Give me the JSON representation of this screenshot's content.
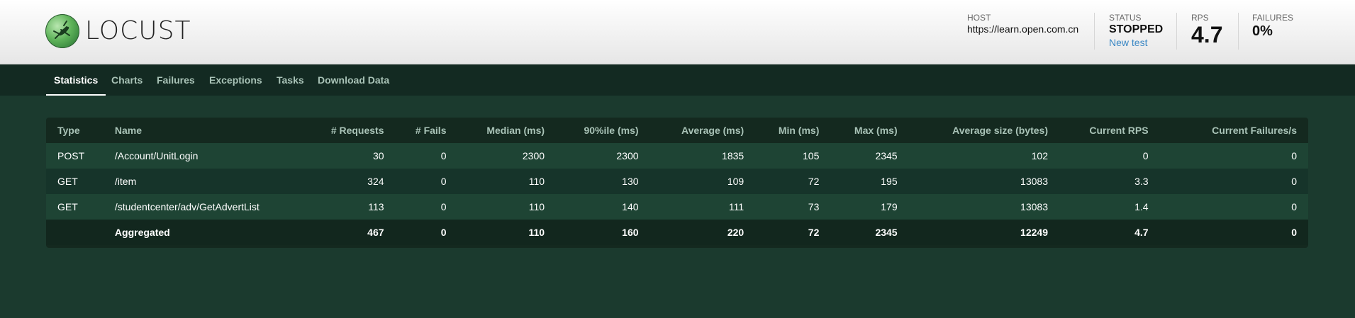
{
  "app": {
    "logo_text": "LOCUST"
  },
  "header": {
    "host_label": "HOST",
    "host_value": "https://learn.open.com.cn",
    "status_label": "STATUS",
    "status_value": "STOPPED",
    "new_test_label": "New test",
    "rps_label": "RPS",
    "rps_value": "4.7",
    "failures_label": "FAILURES",
    "failures_value": "0%"
  },
  "nav": {
    "tabs": [
      {
        "label": "Statistics"
      },
      {
        "label": "Charts"
      },
      {
        "label": "Failures"
      },
      {
        "label": "Exceptions"
      },
      {
        "label": "Tasks"
      },
      {
        "label": "Download Data"
      }
    ],
    "active_tab": "Statistics"
  },
  "table": {
    "columns": [
      "Type",
      "Name",
      "# Requests",
      "# Fails",
      "Median (ms)",
      "90%ile (ms)",
      "Average (ms)",
      "Min (ms)",
      "Max (ms)",
      "Average size (bytes)",
      "Current RPS",
      "Current Failures/s"
    ],
    "rows": [
      [
        "POST",
        "/Account/UnitLogin",
        "30",
        "0",
        "2300",
        "2300",
        "1835",
        "105",
        "2345",
        "102",
        "0",
        "0"
      ],
      [
        "GET",
        "/item",
        "324",
        "0",
        "110",
        "130",
        "109",
        "72",
        "195",
        "13083",
        "3.3",
        "0"
      ],
      [
        "GET",
        "/studentcenter/adv/GetAdvertList",
        "113",
        "0",
        "110",
        "140",
        "111",
        "73",
        "179",
        "13083",
        "1.4",
        "0"
      ]
    ],
    "aggregated": [
      "",
      "Aggregated",
      "467",
      "0",
      "110",
      "160",
      "220",
      "72",
      "2345",
      "12249",
      "4.7",
      "0"
    ]
  },
  "colors": {
    "background": "#1b3a2e",
    "nav_background": "#132a22",
    "link": "#3a87c4"
  }
}
